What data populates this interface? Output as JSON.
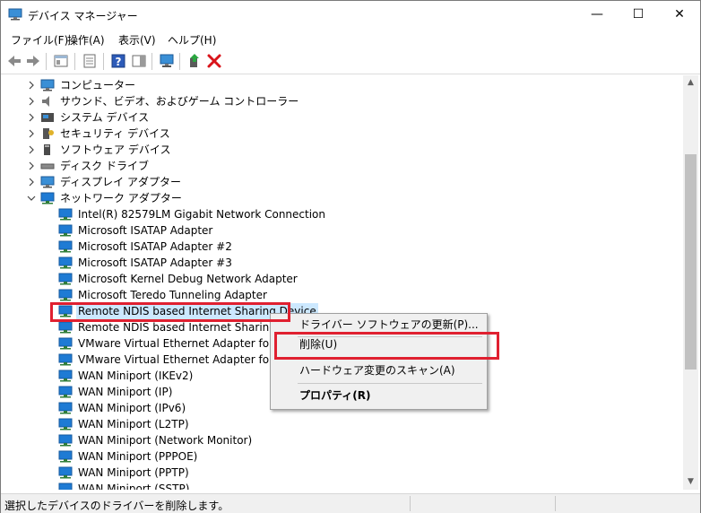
{
  "window": {
    "title": "デバイス マネージャー",
    "minimize_glyph": "—",
    "maximize_glyph": "☐",
    "close_glyph": "✕"
  },
  "menu": [
    "ファイル(F)",
    "操作(A)",
    "表示(V)",
    "ヘルプ(H)"
  ],
  "toolbar": {
    "icons": [
      "back-arrow-icon",
      "forward-arrow-icon",
      "show-hide-tree-icon",
      "properties-icon",
      "help-icon",
      "action-pane-icon",
      "monitor-scan-icon",
      "update-driver-icon",
      "uninstall-x-icon"
    ],
    "uninstall_color": "#d9141b"
  },
  "tree": {
    "categories": [
      {
        "label": "コンピューター",
        "icon": "computer-icon",
        "expanded": false
      },
      {
        "label": "サウンド、ビデオ、およびゲーム コントローラー",
        "icon": "speaker-icon",
        "expanded": false
      },
      {
        "label": "システム デバイス",
        "icon": "system-device-icon",
        "expanded": false
      },
      {
        "label": "セキュリティ デバイス",
        "icon": "security-key-icon",
        "expanded": false
      },
      {
        "label": "ソフトウェア デバイス",
        "icon": "software-device-icon",
        "expanded": false
      },
      {
        "label": "ディスク ドライブ",
        "icon": "disk-drive-icon",
        "expanded": false
      },
      {
        "label": "ディスプレイ アダプター",
        "icon": "display-adapter-icon",
        "expanded": false
      },
      {
        "label": "ネットワーク アダプター",
        "icon": "network-adapter-icon",
        "expanded": true
      }
    ],
    "network_adapters": [
      "Intel(R) 82579LM Gigabit Network Connection",
      "Microsoft ISATAP Adapter",
      "Microsoft ISATAP Adapter #2",
      "Microsoft ISATAP Adapter #3",
      "Microsoft Kernel Debug Network Adapter",
      "Microsoft Teredo Tunneling Adapter",
      "Remote NDIS based Internet Sharing Device",
      "Remote NDIS based Internet Sharing Dev",
      "VMware Virtual Ethernet Adapter for VMı",
      "VMware Virtual Ethernet Adapter for VMı",
      "WAN Miniport (IKEv2)",
      "WAN Miniport (IP)",
      "WAN Miniport (IPv6)",
      "WAN Miniport (L2TP)",
      "WAN Miniport (Network Monitor)",
      "WAN Miniport (PPPOE)",
      "WAN Miniport (PPTP)",
      "WAN Miniport (SSTP)"
    ],
    "selected_index": 6
  },
  "context_menu": {
    "items": [
      {
        "label": "ドライバー ソフトウェアの更新(P)...",
        "bold": false
      },
      {
        "label": "削除(U)",
        "bold": false
      },
      {
        "label": "ハードウェア変更のスキャン(A)",
        "bold": false
      },
      {
        "label": "プロパティ(R)",
        "bold": true
      }
    ]
  },
  "status": {
    "text": "選択したデバイスのドライバーを削除します。"
  },
  "colors": {
    "highlight_box": "#e02030",
    "selection": "#cce8ff",
    "network_icon": "#1e7bd4"
  }
}
